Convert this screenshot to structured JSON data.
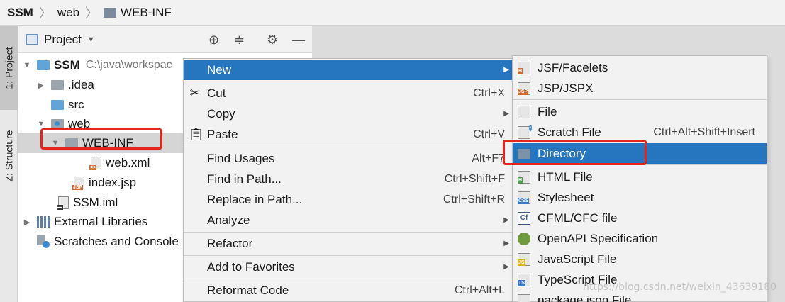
{
  "breadcrumb": [
    "SSM",
    "web",
    "WEB-INF"
  ],
  "side_tabs": {
    "project": "1: Project",
    "structure": "Z: Structure"
  },
  "project_panel": {
    "title": "Project",
    "tree": [
      {
        "label": "SSM",
        "hint": "C:\\java\\workspac",
        "icon": "project-folder-icon"
      },
      {
        "label": ".idea",
        "icon": "folder-icon"
      },
      {
        "label": "src",
        "icon": "source-folder-icon"
      },
      {
        "label": "web",
        "icon": "web-folder-icon"
      },
      {
        "label": "WEB-INF",
        "icon": "folder-icon",
        "selected": true
      },
      {
        "label": "web.xml",
        "icon": "xml-file-icon"
      },
      {
        "label": "index.jsp",
        "icon": "jsp-file-icon"
      },
      {
        "label": "SSM.iml",
        "icon": "iml-file-icon"
      },
      {
        "label": "External Libraries",
        "icon": "libraries-icon"
      },
      {
        "label": "Scratches and Console",
        "icon": "scratches-icon"
      }
    ]
  },
  "context_menu": [
    {
      "label": "New",
      "shortcut": "",
      "submenu": true,
      "highlight": true
    },
    {
      "label": "Cut",
      "shortcut": "Ctrl+X",
      "icon": "scissors-icon"
    },
    {
      "label": "Copy",
      "shortcut": "",
      "submenu": true
    },
    {
      "label": "Paste",
      "shortcut": "Ctrl+V",
      "icon": "clipboard-icon"
    },
    {
      "label": "Find Usages",
      "shortcut": "Alt+F7"
    },
    {
      "label": "Find in Path...",
      "shortcut": "Ctrl+Shift+F"
    },
    {
      "label": "Replace in Path...",
      "shortcut": "Ctrl+Shift+R"
    },
    {
      "label": "Analyze",
      "shortcut": "",
      "submenu": true
    },
    {
      "label": "Refactor",
      "shortcut": "",
      "submenu": true
    },
    {
      "label": "Add to Favorites",
      "shortcut": "",
      "submenu": true
    },
    {
      "label": "Reformat Code",
      "shortcut": "Ctrl+Alt+L"
    }
  ],
  "new_submenu": [
    {
      "label": "JSF/Facelets",
      "icon": "jsf-icon"
    },
    {
      "label": "JSP/JSPX",
      "icon": "jsp-icon"
    },
    {
      "label": "File",
      "icon": "file-icon"
    },
    {
      "label": "Scratch File",
      "shortcut": "Ctrl+Alt+Shift+Insert",
      "icon": "scratch-file-icon"
    },
    {
      "label": "Directory",
      "icon": "directory-icon",
      "highlight": true
    },
    {
      "label": "HTML File",
      "icon": "html-file-icon"
    },
    {
      "label": "Stylesheet",
      "icon": "css-file-icon"
    },
    {
      "label": "CFML/CFC file",
      "icon": "cfml-icon"
    },
    {
      "label": "OpenAPI Specification",
      "icon": "openapi-icon"
    },
    {
      "label": "JavaScript File",
      "icon": "js-file-icon"
    },
    {
      "label": "TypeScript File",
      "icon": "ts-file-icon"
    },
    {
      "label": "package.json File",
      "icon": "package-json-icon"
    }
  ],
  "watermark": "https://blog.csdn.net/weixin_43639180",
  "colors": {
    "highlight": "#2675bf",
    "annotation": "#e2261c"
  }
}
